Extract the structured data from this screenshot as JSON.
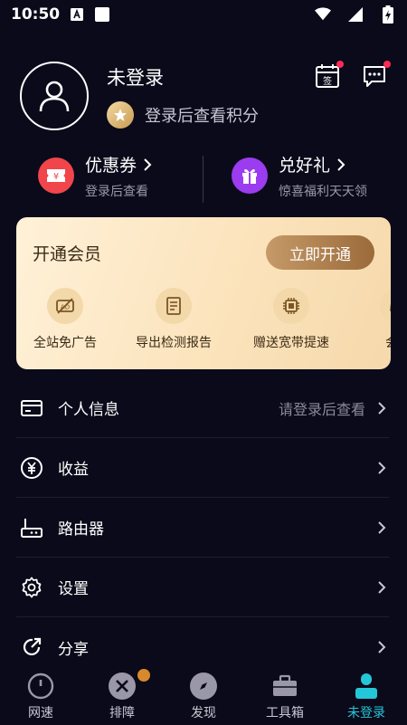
{
  "status_bar": {
    "time": "10:50"
  },
  "profile": {
    "username": "未登录",
    "points_text": "登录后查看积分",
    "sign_icon_label": "签"
  },
  "coupons": [
    {
      "title": "优惠券",
      "subtitle": "登录后查看",
      "icon": "ticket-icon",
      "color": "#f0464b"
    },
    {
      "title": "兑好礼",
      "subtitle": "惊喜福利天天领",
      "icon": "gift-icon",
      "color": "#9b3cf0"
    }
  ],
  "vip": {
    "title": "开通会员",
    "button": "立即开通",
    "perks": [
      "全站免广告",
      "导出检测报告",
      "赠送宽带提速",
      "会员"
    ]
  },
  "menu": {
    "items": [
      {
        "label": "个人信息",
        "hint": "请登录后查看",
        "icon": "id-card-icon"
      },
      {
        "label": "收益",
        "hint": "",
        "icon": "yuan-coin-icon"
      },
      {
        "label": "路由器",
        "hint": "",
        "icon": "router-icon"
      },
      {
        "label": "设置",
        "hint": "",
        "icon": "gear-icon"
      },
      {
        "label": "分享",
        "hint": "",
        "icon": "share-icon"
      }
    ]
  },
  "tabs": [
    {
      "label": "网速",
      "icon": "speedometer-icon"
    },
    {
      "label": "排障",
      "icon": "tools-icon"
    },
    {
      "label": "发现",
      "icon": "compass-icon"
    },
    {
      "label": "工具箱",
      "icon": "toolbox-icon"
    },
    {
      "label": "未登录",
      "icon": "user-icon",
      "active": true
    }
  ],
  "colors": {
    "accent": "#24c7d8",
    "badge_red": "#ff2a55",
    "background": "#0b0a1a"
  }
}
